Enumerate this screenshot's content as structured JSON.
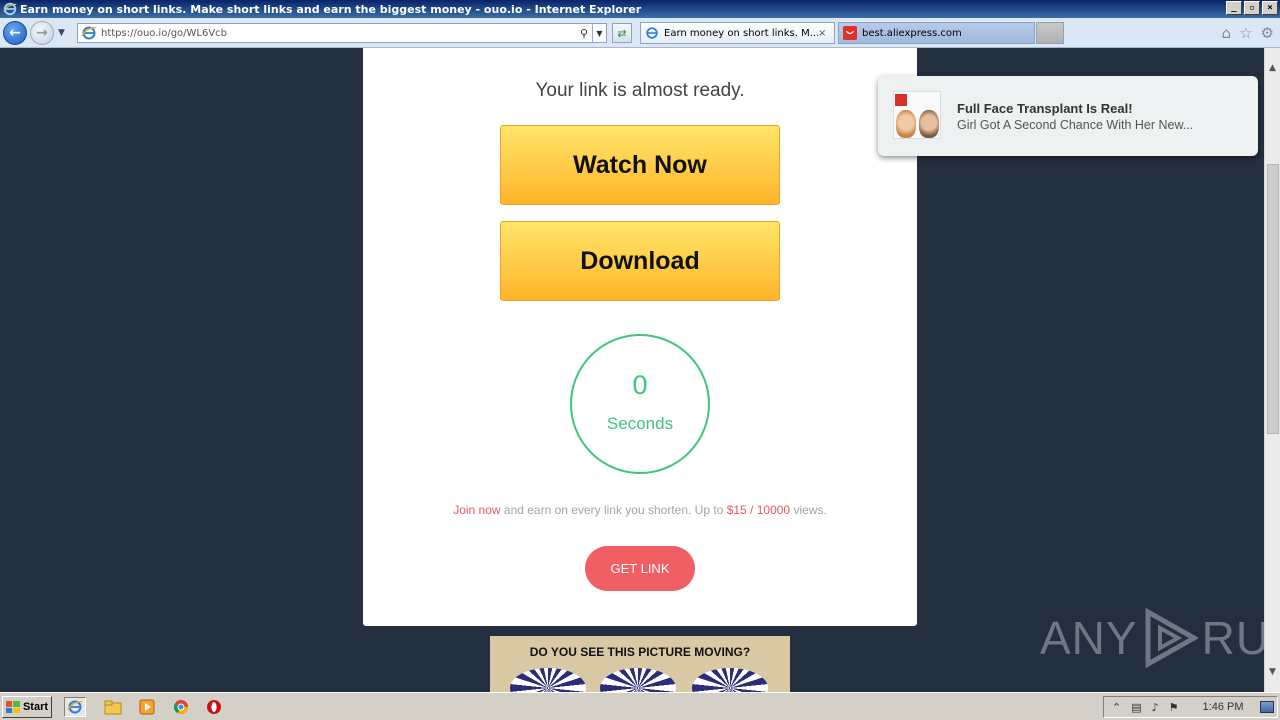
{
  "window": {
    "title": "Earn money on short links. Make short links and earn the biggest money - ouo.io - Internet Explorer",
    "controls": [
      "_",
      "▫",
      "×"
    ]
  },
  "navbar": {
    "url": "https://ouo.io/go/WL6Vcb",
    "tabs": [
      {
        "label": "Earn money on short links. M...",
        "active": true,
        "close": "×"
      },
      {
        "label": "best.aliexpress.com",
        "active": false
      }
    ]
  },
  "page": {
    "heading": "Your link is almost ready.",
    "watch_label": "Watch Now",
    "download_label": "Download",
    "counter": {
      "value": "0",
      "unit": "Seconds"
    },
    "promo": {
      "join": "Join now",
      "middle": " and earn on every link you shorten. Up to ",
      "rate": "$15 / 10000",
      "end": " views."
    },
    "get_link_label": "GET LINK",
    "ad_title": "DO YOU SEE THIS PICTURE MOVING?"
  },
  "notification": {
    "title": "Full Face Transplant Is Real!",
    "body": "Girl Got A Second Chance With Her New..."
  },
  "watermark": {
    "left": "ANY",
    "right": "RUN"
  },
  "taskbar": {
    "start_label": "Start",
    "clock": "1:46 PM"
  },
  "colors": {
    "page_bg": "#232e3f",
    "button_yellow": "#ffc53d",
    "counter_green": "#3ec67a",
    "accent_red": "#ef5f63"
  }
}
